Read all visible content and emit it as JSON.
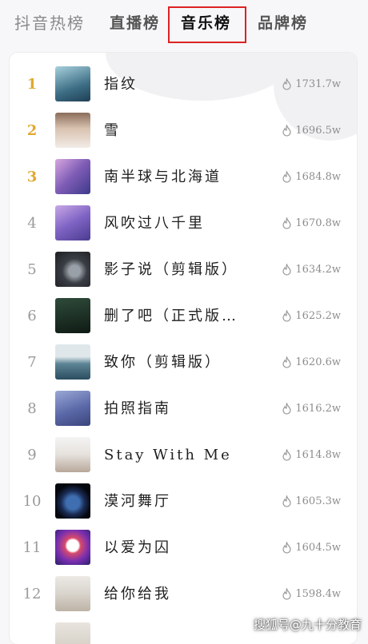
{
  "tabs": [
    {
      "label": "抖音热榜",
      "active": false
    },
    {
      "label": "直播榜",
      "active": false
    },
    {
      "label": "音乐榜",
      "active": true
    },
    {
      "label": "品牌榜",
      "active": false
    }
  ],
  "items": [
    {
      "rank": "1",
      "title": "指纹",
      "heat": "1731.7w"
    },
    {
      "rank": "2",
      "title": "雪",
      "heat": "1696.5w"
    },
    {
      "rank": "3",
      "title": "南半球与北海道",
      "heat": "1684.8w"
    },
    {
      "rank": "4",
      "title": "风吹过八千里",
      "heat": "1670.8w"
    },
    {
      "rank": "5",
      "title": "影子说（剪辑版）",
      "heat": "1634.2w"
    },
    {
      "rank": "6",
      "title": "删了吧（正式版…",
      "heat": "1625.2w"
    },
    {
      "rank": "7",
      "title": "致你（剪辑版）",
      "heat": "1620.6w"
    },
    {
      "rank": "8",
      "title": "拍照指南",
      "heat": "1616.2w"
    },
    {
      "rank": "9",
      "title": "Stay With Me",
      "heat": "1614.8w"
    },
    {
      "rank": "10",
      "title": "漠河舞厅",
      "heat": "1605.3w"
    },
    {
      "rank": "11",
      "title": "以爱为囚",
      "heat": "1604.5w"
    },
    {
      "rank": "12",
      "title": "给你给我",
      "heat": "1598.4w"
    }
  ],
  "watermark": "搜狐号@九十分教育",
  "colors": {
    "top_rank": "#e0a92f",
    "highlight_box": "#dd2222"
  }
}
